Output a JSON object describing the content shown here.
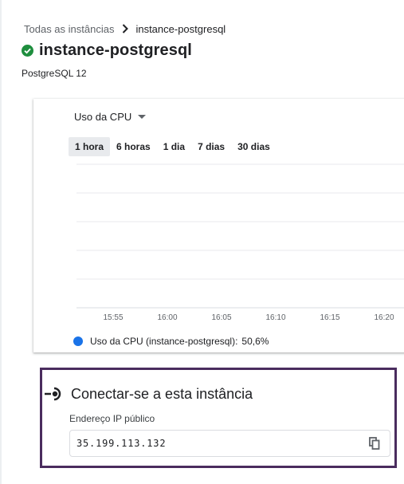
{
  "breadcrumb": {
    "parent": "Todas as instâncias",
    "current": "instance-postgresql"
  },
  "instance": {
    "name": "instance-postgresql",
    "status_icon": "check-circle-icon",
    "version": "PostgreSQL 12"
  },
  "metrics_card": {
    "metric_select": "Uso da CPU",
    "time_ranges": [
      "1 hora",
      "6 horas",
      "1 dia",
      "7 dias",
      "30 dias"
    ],
    "active_range": "1 hora",
    "legend": {
      "label": "Uso da CPU (instance-postgresql):",
      "value": "50,6%"
    }
  },
  "chart_data": {
    "type": "line",
    "x_ticks": [
      "15:55",
      "16:00",
      "16:05",
      "16:10",
      "16:15",
      "16:20"
    ],
    "series": [
      {
        "name": "Uso da CPU (instance-postgresql)",
        "color": "#1a73e8",
        "values": []
      }
    ],
    "grid": true,
    "legend_position": "bottom-left"
  },
  "connect": {
    "title": "Conectar-se a esta instância",
    "icon": "connect-plug-icon",
    "ip_label": "Endereço IP público",
    "ip_value": "35.199.113.132",
    "copy_icon": "copy-icon"
  },
  "colors": {
    "accent": "#1a73e8",
    "status_ok": "#1e8e3e",
    "highlight_border": "#4a2c5e"
  }
}
